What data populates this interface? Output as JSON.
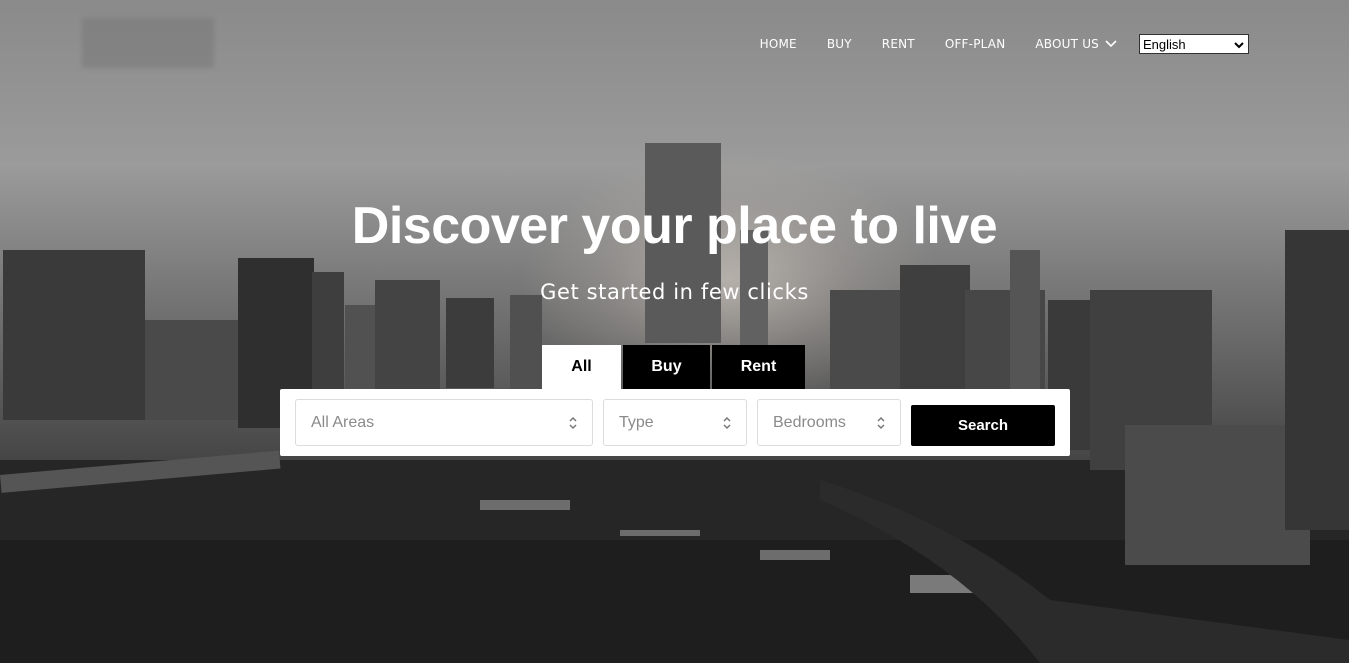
{
  "nav": {
    "items": [
      {
        "label": "HOME"
      },
      {
        "label": "BUY"
      },
      {
        "label": "RENT"
      },
      {
        "label": "OFF-PLAN"
      },
      {
        "label": "ABOUT US",
        "icon": "chevron-down-icon"
      }
    ],
    "language": {
      "selected": "English"
    }
  },
  "hero": {
    "title": "Discover your place to live",
    "subtitle": "Get started in few clicks"
  },
  "tabs": [
    {
      "label": "All",
      "active": true
    },
    {
      "label": "Buy",
      "active": false
    },
    {
      "label": "Rent",
      "active": false
    }
  ],
  "search": {
    "areas_placeholder": "All Areas",
    "type_placeholder": "Type",
    "bedrooms_placeholder": "Bedrooms",
    "button_label": "Search"
  },
  "colors": {
    "accent": "#000000",
    "text_light": "#ffffff",
    "placeholder": "#8a8a8a"
  }
}
